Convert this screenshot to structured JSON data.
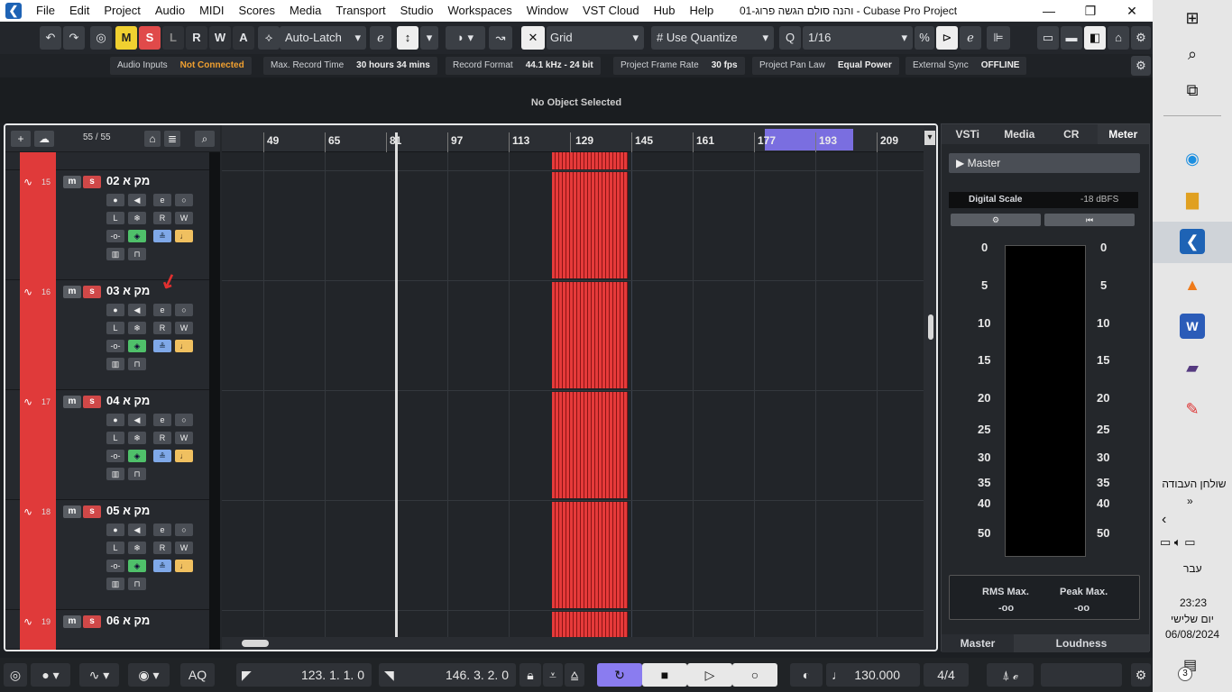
{
  "menubar": {
    "items": [
      "File",
      "Edit",
      "Project",
      "Audio",
      "MIDI",
      "Scores",
      "Media",
      "Transport",
      "Studio",
      "Workspaces",
      "Window",
      "VST Cloud",
      "Hub",
      "Help"
    ],
    "title": "Cubase Pro Project - והנה סולם הגשה פרוג-01",
    "win_min": "—",
    "win_max": "❐",
    "win_close": "✕"
  },
  "toolbar": {
    "m": "M",
    "s": "S",
    "l": "L",
    "r": "R",
    "w": "W",
    "a": "A",
    "automation_mode": "Auto-Latch",
    "snap_type": "Grid",
    "quantize_mode": "Use Quantize",
    "quantize_value": "1/16"
  },
  "status": {
    "audio_inputs_label": "Audio Inputs",
    "audio_inputs_value": "Not Connected",
    "max_record_label": "Max. Record Time",
    "max_record_value": "30 hours 34 mins",
    "record_format_label": "Record Format",
    "record_format_value": "44.1 kHz - 24 bit",
    "frame_rate_label": "Project Frame Rate",
    "frame_rate_value": "30 fps",
    "pan_law_label": "Project Pan Law",
    "pan_law_value": "Equal Power",
    "ext_sync_label": "External Sync",
    "ext_sync_value": "OFFLINE"
  },
  "info_line": "No Object Selected",
  "track_toolbar": {
    "count": "55 / 55"
  },
  "tracks": [
    {
      "num": "15",
      "name": "מק א 02"
    },
    {
      "num": "16",
      "name": "מק א 03"
    },
    {
      "num": "17",
      "name": "מק א 04"
    },
    {
      "num": "18",
      "name": "מק א 05"
    },
    {
      "num": "19",
      "name": "מק א 06"
    }
  ],
  "ruler": {
    "bars": [
      "49",
      "65",
      "81",
      "97",
      "113",
      "129",
      "145",
      "161",
      "177",
      "193",
      "209"
    ]
  },
  "right_zone": {
    "tabs": [
      "VSTi",
      "Media",
      "CR",
      "Meter"
    ],
    "master": "Master",
    "digital_scale_label": "Digital Scale",
    "digital_scale_value": "-18 dBFS",
    "meter_marks": [
      "0",
      "5",
      "10",
      "15",
      "20",
      "25",
      "30",
      "35",
      "40",
      "50"
    ],
    "rms_label": "RMS Max.",
    "rms_value": "-oo",
    "peak_label": "Peak Max.",
    "peak_value": "-oo",
    "bottom_tabs": [
      "Master",
      "Loudness"
    ]
  },
  "transport": {
    "left_locator": "123. 1. 1.  0",
    "right_locator": "146. 3. 2.  0",
    "aq": "AQ",
    "tempo": "130.000",
    "signature": "4/4"
  },
  "taskbar": {
    "desktop_label": "שולחן העבודה",
    "lang": "עבר",
    "time": "23:23",
    "day": "יום שלישי",
    "date": "06/08/2024",
    "notif_count": "3"
  }
}
